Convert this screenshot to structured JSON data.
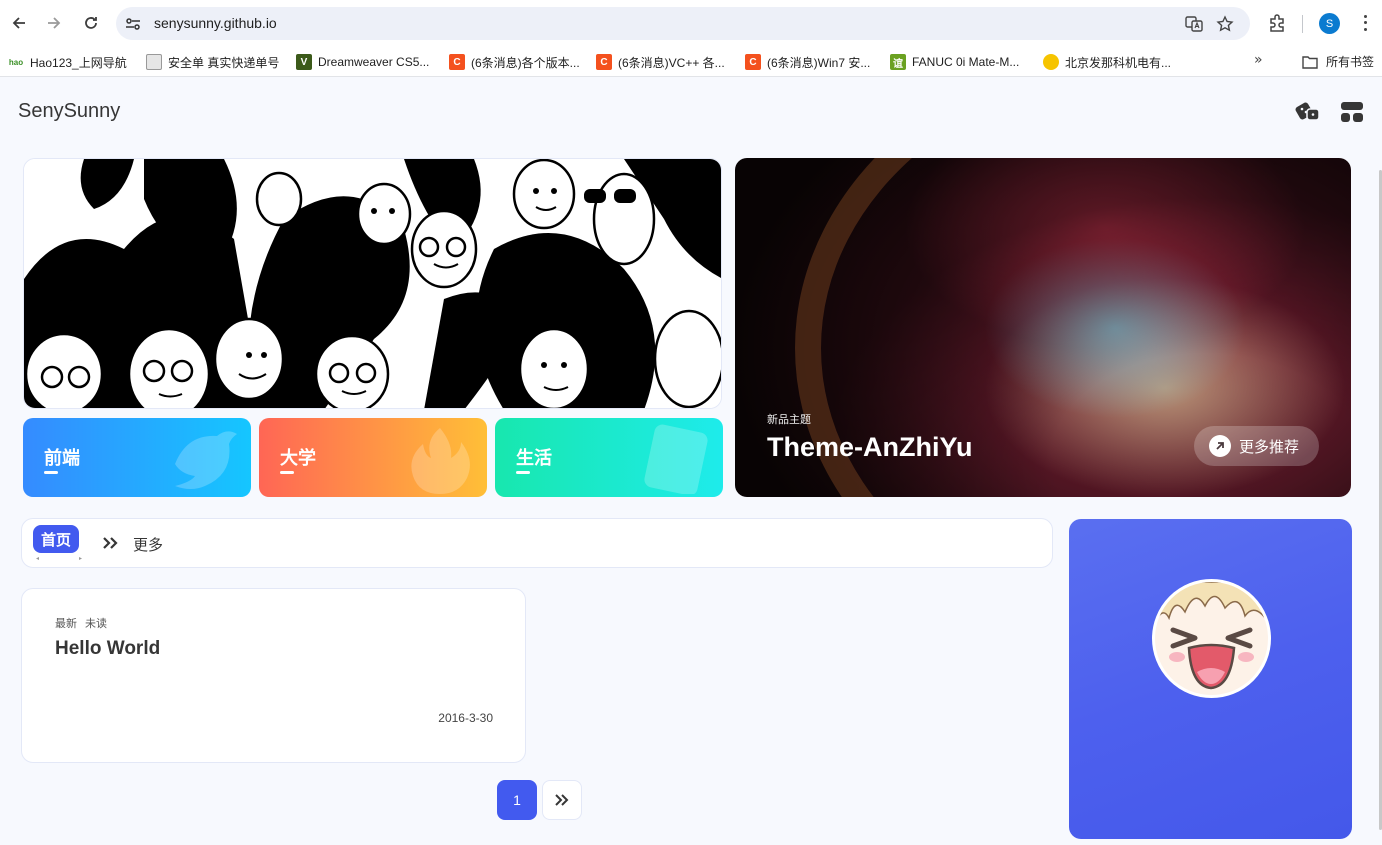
{
  "browser": {
    "url": "senysunny.github.io",
    "profile_initial": "S",
    "bookmarks": [
      {
        "label": "Hao123_上网导航",
        "icon": "hao123-icon"
      },
      {
        "label": "安全单 真实快递单号",
        "icon": "box-icon"
      },
      {
        "label": "Dreamweaver CS5...",
        "icon": "dreamweaver-icon"
      },
      {
        "label": "(6条消息)各个版本...",
        "icon": "csdn-icon"
      },
      {
        "label": "(6条消息)VC++ 各...",
        "icon": "csdn-icon"
      },
      {
        "label": "(6条消息)Win7 安...",
        "icon": "csdn-icon"
      },
      {
        "label": "FANUC 0i Mate-M...",
        "icon": "fanuc-icon"
      },
      {
        "label": "北京发那科机电有...",
        "icon": "company-icon"
      }
    ],
    "all_bookmarks_label": "所有书签",
    "more_bookmarks": "»"
  },
  "site": {
    "title": "SenySunny"
  },
  "categories": [
    {
      "label": "前端",
      "color_from": "#358bff",
      "color_to": "#15c6ff"
    },
    {
      "label": "大学",
      "color_from": "#ff6655",
      "color_to": "#ffbf37"
    },
    {
      "label": "生活",
      "color_from": "#18e7ae",
      "color_to": "#1eebeb"
    }
  ],
  "feature": {
    "tag": "新品主题",
    "title": "Theme-AnZhiYu",
    "button": "更多推荐"
  },
  "category_bar": {
    "active": "首页",
    "more": "更多"
  },
  "posts": [
    {
      "tags": [
        "最新",
        "未读"
      ],
      "title": "Hello World",
      "date": "2016-3-30"
    }
  ],
  "pagination": {
    "current": "1"
  },
  "colors": {
    "accent": "#425aef",
    "background": "#f7f9fe"
  }
}
